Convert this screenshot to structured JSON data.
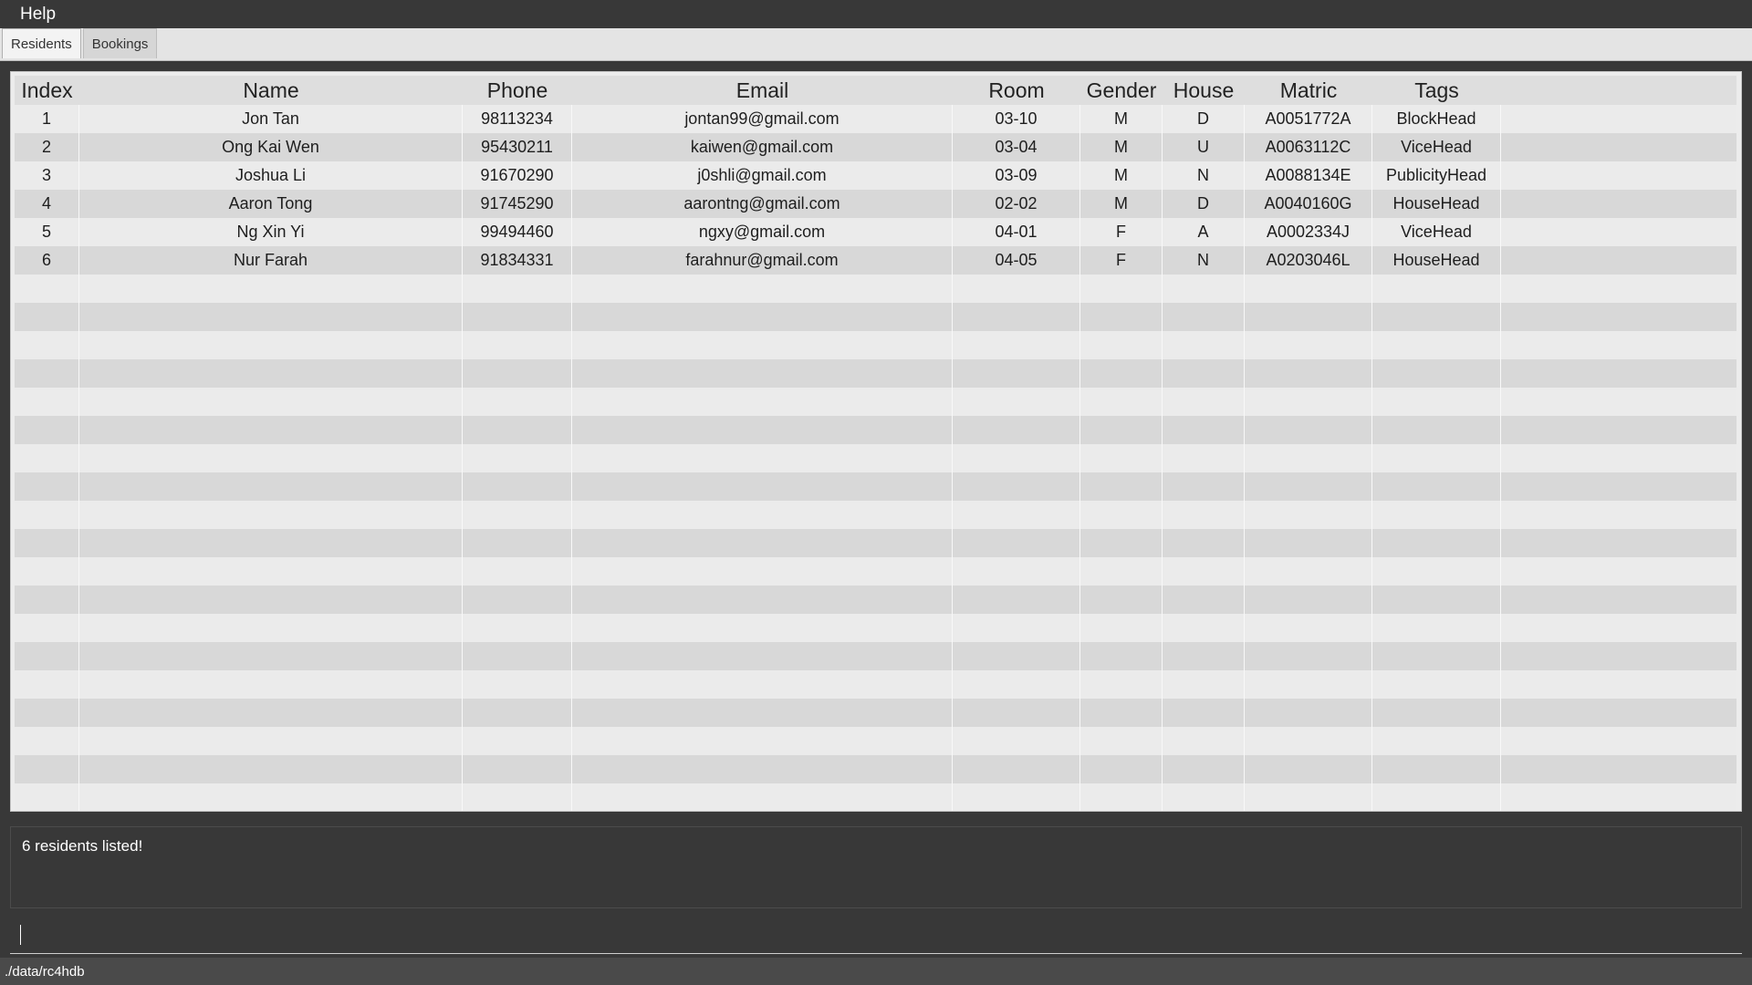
{
  "menubar": {
    "help_label": "Help"
  },
  "tabs": [
    {
      "label": "Residents",
      "active": true
    },
    {
      "label": "Bookings",
      "active": false
    }
  ],
  "table": {
    "columns": [
      "Index",
      "Name",
      "Phone",
      "Email",
      "Room",
      "Gender",
      "House",
      "Matric",
      "Tags"
    ],
    "rows": [
      [
        "1",
        "Jon Tan",
        "98113234",
        "jontan99@gmail.com",
        "03-10",
        "M",
        "D",
        "A0051772A",
        "BlockHead"
      ],
      [
        "2",
        "Ong Kai Wen",
        "95430211",
        "kaiwen@gmail.com",
        "03-04",
        "M",
        "U",
        "A0063112C",
        "ViceHead"
      ],
      [
        "3",
        "Joshua Li",
        "91670290",
        "j0shli@gmail.com",
        "03-09",
        "M",
        "N",
        "A0088134E",
        "PublicityHead"
      ],
      [
        "4",
        "Aaron Tong",
        "91745290",
        "aarontng@gmail.com",
        "02-02",
        "M",
        "D",
        "A0040160G",
        "HouseHead"
      ],
      [
        "5",
        "Ng Xin Yi",
        "99494460",
        "ngxy@gmail.com",
        "04-01",
        "F",
        "A",
        "A0002334J",
        "ViceHead"
      ],
      [
        "6",
        "Nur Farah",
        "91834331",
        "farahnur@gmail.com",
        "04-05",
        "F",
        "N",
        "A0203046L",
        "HouseHead"
      ]
    ]
  },
  "result": {
    "message": "6 residents listed!"
  },
  "command": {
    "value": "",
    "placeholder": ""
  },
  "status": {
    "path": "./data/rc4hdb"
  }
}
